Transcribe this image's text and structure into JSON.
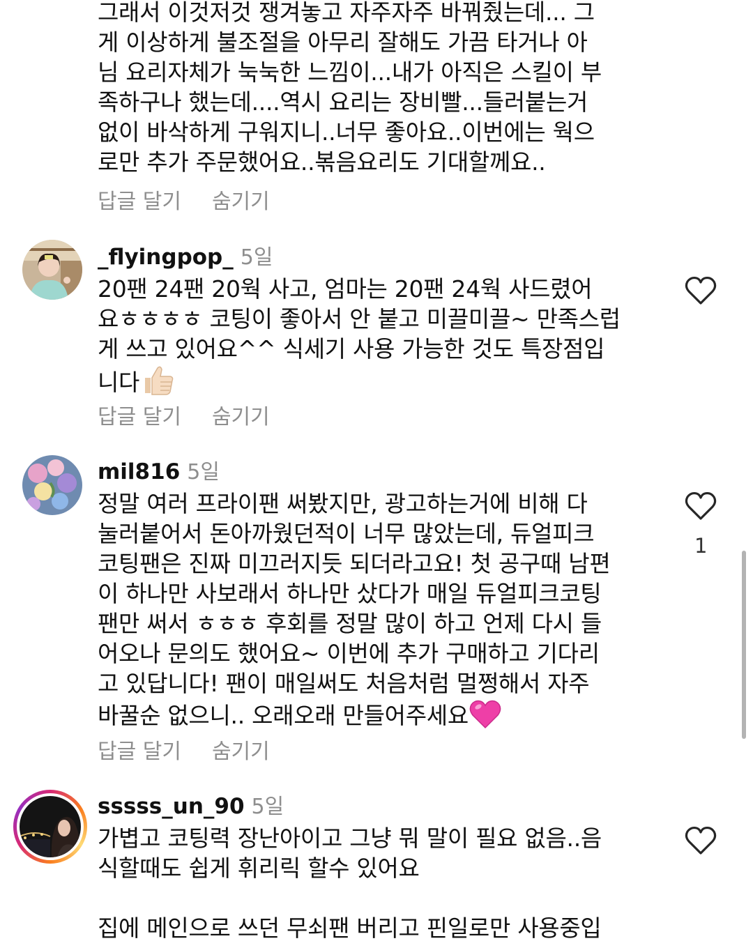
{
  "top_comment": {
    "text": "그래서 이것저것 쟁겨놓고 자주자주 바꿔줬는데... 그\n게 이상하게  불조절을 아무리 잘해도 가끔 타거나 아\n님 요리자체가  눅눅한 느낌이...내가 아직은 스킬이 부\n족하구나 했는데....역시 요리는 장비빨...들러붙는거\n없이 바삭하게 구워지니..너무 좋아요..이번에는 웍으\n로만 추가 주문했어요..볶음요리도 기대할께요..",
    "reply_label": "답글 달기",
    "hide_label": "숨기기"
  },
  "comments": [
    {
      "username": "_flyingpop_",
      "time": "5일",
      "text": "20팬 24팬 20웍 사고, 엄마는 20팬 24웍 사드렸어\n요ㅎㅎㅎㅎ 코팅이 좋아서 안 붙고 미끌미끌~ 만족스럽\n게 쓰고 있어요^^ 식세기 사용 가능한 것도 특장점입\n니다",
      "emoji": "thumbs-up",
      "reply_label": "답글 달기",
      "hide_label": "숨기기"
    },
    {
      "username": "mil816",
      "time": "5일",
      "text": "정말 여러 프라이팬 써봤지만, 광고하는거에 비해 다\n눌러붙어서 돈아까웠던적이 너무 많았는데, 듀얼피크\n코팅팬은 진짜 미끄러지듯 되더라고요! 첫 공구때 남편\n이 하나만 사보래서 하나만 샀다가 매일 듀얼피크코팅\n팬만 써서 ㅎㅎㅎ 후회를 정말 많이 하고 언제 다시 들\n어오나 문의도 했어요~ 이번에 추가 구매하고 기다리\n고 있답니다! 팬이 매일써도 처음처럼 멀쩡해서 자주\n바꿀순 없으니.. 오래오래 만들어주세요",
      "emoji": "pink-heart",
      "likes": "1",
      "reply_label": "답글 달기",
      "hide_label": "숨기기"
    },
    {
      "username": "sssss_un_90",
      "time": "5일",
      "text": "가볍고 코팅력 장난아이고 그냥 뭐 말이 필요 없음..음\n식할때도 쉽게 휘리릭 할수 있어요\n\n집에 메인으로 쓰던 무쇠팬 버리고 핀일로만 사용중입\n니다. 백마디 말보다 한번 써보면 무슨말인지 말안해도"
    }
  ],
  "icons": {
    "like": "heart-outline-icon",
    "thumbs_up": "thumbs-up-emoji",
    "pink_heart": "pink-heart-emoji"
  },
  "colors": {
    "text": "#111111",
    "secondary": "#8e8e8e",
    "story_ring": "#d62976"
  }
}
